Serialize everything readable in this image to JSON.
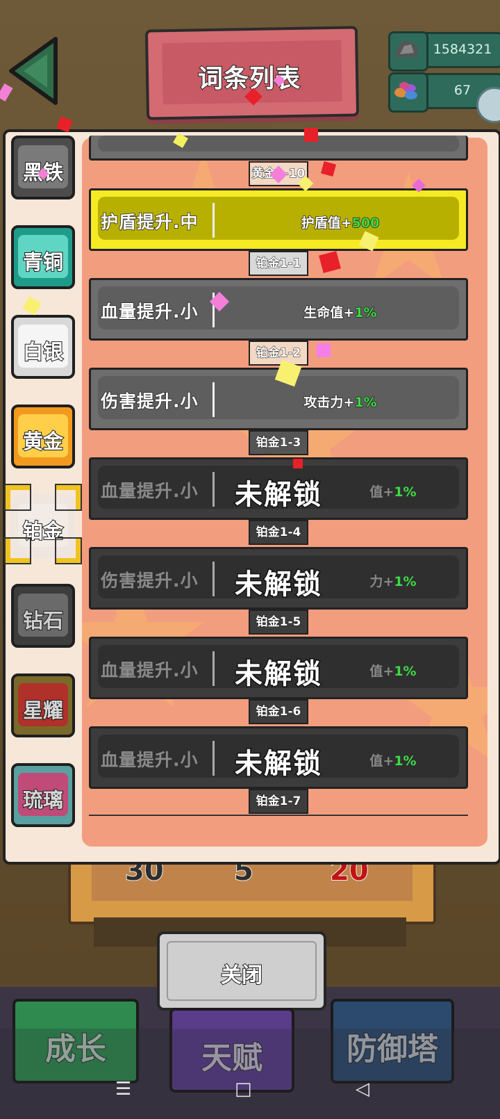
{
  "header": {
    "title": "词条列表"
  },
  "currencies": [
    {
      "icon": "ore-icon",
      "value": "1584321"
    },
    {
      "icon": "gems-icon",
      "value": "67"
    }
  ],
  "tabs": [
    "黑铁",
    "青铜",
    "白银",
    "黄金",
    "铂金",
    "钻石",
    "星耀",
    "琉璃"
  ],
  "selected_tab": "铂金",
  "top_code": "黄金1-10",
  "entries": [
    {
      "name": "护盾提升.中",
      "effect_text": "护盾值+",
      "effect_value": "500",
      "code": "铂金1-1"
    },
    {
      "name": "血量提升.小",
      "effect_text": "生命值+",
      "effect_value": "1%",
      "code": "铂金1-2"
    },
    {
      "name": "伤害提升.小",
      "effect_text": "攻击力+",
      "effect_value": "1%",
      "code": "铂金1-3"
    },
    {
      "name": "血量提升.小",
      "effect_text": "值+",
      "effect_value": "1%",
      "code": "铂金1-4",
      "locked_label": "未解锁"
    },
    {
      "name": "伤害提升.小",
      "effect_text": "力+",
      "effect_value": "1%",
      "code": "铂金1-5",
      "locked_label": "未解锁"
    },
    {
      "name": "血量提升.小",
      "effect_text": "值+",
      "effect_value": "1%",
      "code": "铂金1-6",
      "locked_label": "未解锁"
    },
    {
      "name": "血量提升.小",
      "effect_text": "值+",
      "effect_value": "1%",
      "code": "铂金1-7",
      "locked_label": "未解锁"
    }
  ],
  "tray_values": [
    "30",
    "5",
    "20"
  ],
  "close_label": "关闭",
  "nav": {
    "growth": "成长",
    "talent": "天赋",
    "tower": "防御塔"
  },
  "colors": {
    "highlight": "#f6ea24",
    "positive": "#3ddb43",
    "selected_frame": "#f0c322"
  }
}
